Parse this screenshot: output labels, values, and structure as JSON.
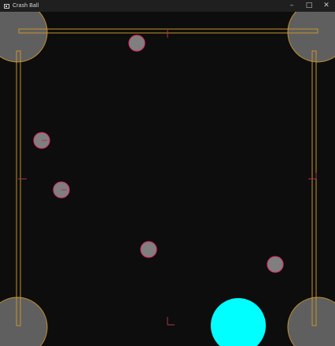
{
  "window": {
    "title": "Crash Ball",
    "minimize_glyph": "–",
    "maximize_glyph": "□",
    "close_glyph": "✕",
    "app_icon": "window-app-icon"
  },
  "colors": {
    "background": "#0d0d0d",
    "titlebar": "#1f1f1f",
    "paddle_outline": "#c8932c",
    "post_fill": "#5f5f5f",
    "ball_fill": "#7f7f7f",
    "ball_outline": "#d43a6a",
    "player_ball": "#00ffff",
    "marker": "#b0324c"
  },
  "game": {
    "balls_count": 5
  }
}
